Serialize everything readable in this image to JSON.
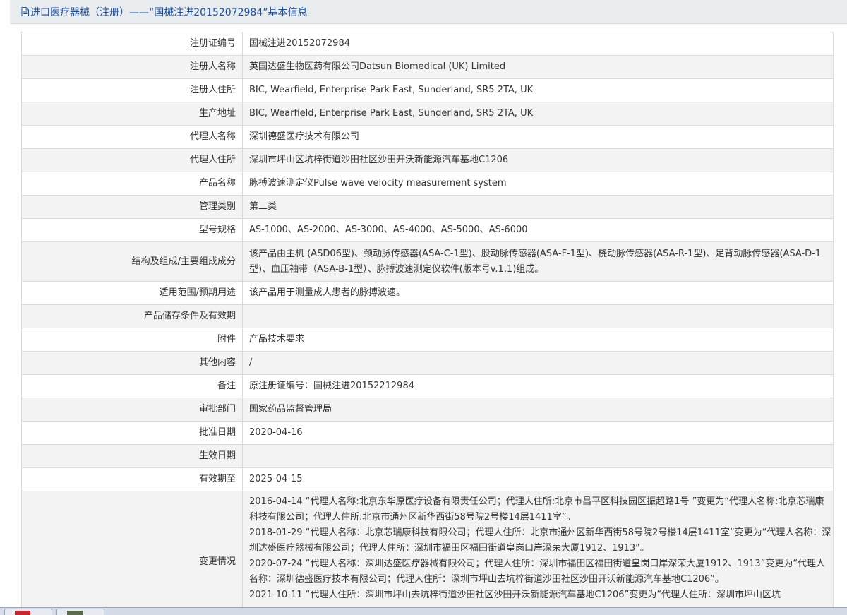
{
  "header": {
    "icon": "document-icon",
    "title": "进口医疗器械（注册）——“国械注进20152072984”基本信息",
    "color": "#1a4fa0"
  },
  "rows": [
    {
      "label": "注册证编号",
      "value": "国械注进20152072984"
    },
    {
      "label": "注册人名称",
      "value": "英国达盛生物医药有限公司Datsun Biomedical (UK) Limited"
    },
    {
      "label": "注册人住所",
      "value": "BIC, Wearfield, Enterprise Park East, Sunderland, SR5 2TA, UK"
    },
    {
      "label": "生产地址",
      "value": "BIC, Wearfield, Enterprise Park East, Sunderland, SR5 2TA, UK"
    },
    {
      "label": "代理人名称",
      "value": "深圳德盛医疗技术有限公司"
    },
    {
      "label": "代理人住所",
      "value": "深圳市坪山区坑梓街道沙田社区沙田开沃新能源汽车基地C1206"
    },
    {
      "label": "产品名称",
      "value": "脉搏波速测定仪Pulse wave velocity measurement system"
    },
    {
      "label": "管理类别",
      "value": "第二类"
    },
    {
      "label": "型号规格",
      "value": "AS-1000、AS-2000、AS-3000、AS-4000、AS-5000、AS-6000"
    },
    {
      "label": "结构及组成/主要组成成分",
      "value": "该产品由主机 (ASD06型)、颈动脉传感器(ASA-C-1型)、股动脉传感器(ASA-F-1型)、桡动脉传感器(ASA-R-1型)、足背动脉传感器(ASA-D-1型)、血压袖带（ASA-B-1型）、脉搏波速测定仪软件(版本号v.1.1)组成。"
    },
    {
      "label": "适用范围/预期用途",
      "value": "该产品用于测量成人患者的脉搏波速。"
    },
    {
      "label": "产品储存条件及有效期",
      "value": ""
    },
    {
      "label": "附件",
      "value": "产品技术要求"
    },
    {
      "label": "其他内容",
      "value": "/"
    },
    {
      "label": "备注",
      "value": "原注册证编号：国械注进20152212984"
    },
    {
      "label": "审批部门",
      "value": "国家药品监督管理局"
    },
    {
      "label": "批准日期",
      "value": "2020-04-16"
    },
    {
      "label": "生效日期",
      "value": ""
    },
    {
      "label": "有效期至",
      "value": "2025-04-15"
    }
  ],
  "changes": {
    "label": "变更情况",
    "items": [
      "2016-04-14 “代理人名称:北京东华原医疗设备有限责任公司；代理人住所:北京市昌平区科技园区振超路1号 ”变更为“代理人名称:北京芯瑞康科技有限公司；代理人住所:北京市通州区新华西街58号院2号楼14层1411室”。",
      "2018-01-29 “代理人名称：北京芯瑞康科技有限公司；代理人住所：北京市通州区新华西街58号院2号楼14层1411室”变更为“代理人名称：深圳达盛医疗器械有限公司；代理人住所：深圳市福田区福田街道皇岗口岸深荣大厦1912、1913”。",
      "2020-07-24 “代理人名称：深圳达盛医疗器械有限公司；代理人住所：深圳市福田区福田街道皇岗口岸深荣大厦1912、1913”变更为“代理人名称：深圳德盛医疗技术有限公司；代理人住所：深圳市坪山去坑梓街道沙田社区沙田开沃新能源汽车基地C1206”。",
      "2021-10-11 “代理人住所：深圳市坪山去坑梓街道沙田社区沙田开沃新能源汽车基地C1206”变更为“代理人住所：深圳市坪山区坑"
    ]
  },
  "taskbar": {
    "buttons": [
      "taskbar-app-1",
      "taskbar-app-2"
    ]
  }
}
